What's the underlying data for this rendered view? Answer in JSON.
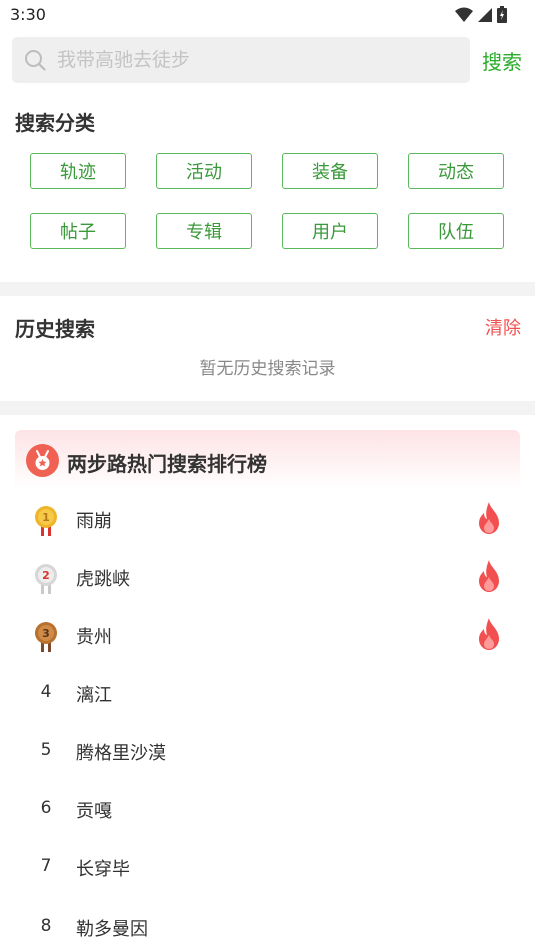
{
  "status_bar": {
    "time": "3:30"
  },
  "search": {
    "placeholder": "我带高驰去徒步",
    "button_label": "搜索"
  },
  "categories": {
    "title": "搜索分类",
    "items": [
      "轨迹",
      "活动",
      "装备",
      "动态",
      "帖子",
      "专辑",
      "用户",
      "队伍"
    ]
  },
  "history": {
    "title": "历史搜索",
    "clear_label": "清除",
    "empty_text": "暂无历史搜索记录"
  },
  "ranking": {
    "title": "两步路热门搜索排行榜",
    "items": [
      {
        "rank": "1",
        "name": "雨崩",
        "hot": true,
        "medal": "gold"
      },
      {
        "rank": "2",
        "name": "虎跳峡",
        "hot": true,
        "medal": "silver"
      },
      {
        "rank": "3",
        "name": "贵州",
        "hot": true,
        "medal": "bronze"
      },
      {
        "rank": "4",
        "name": "漓江",
        "hot": false
      },
      {
        "rank": "5",
        "name": "腾格里沙漠",
        "hot": false
      },
      {
        "rank": "6",
        "name": "贡嘎",
        "hot": false
      },
      {
        "rank": "7",
        "name": "长穿毕",
        "hot": false
      },
      {
        "rank": "8",
        "name": "勒多曼因",
        "hot": false
      }
    ]
  },
  "colors": {
    "accent_green": "#2aab2a",
    "clear_red": "#f25050",
    "fire": "#f25050"
  }
}
